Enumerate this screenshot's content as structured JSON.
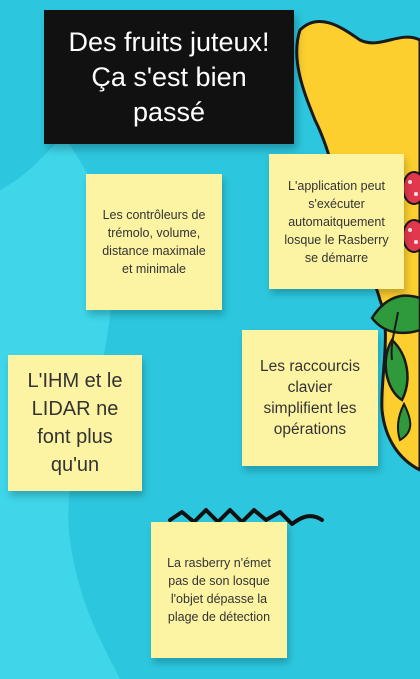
{
  "title_card": {
    "text": "Des fruits juteux!\nÇa s'est bien\npassé"
  },
  "notes": [
    {
      "text": "Les contrôleurs de trémolo, volume, distance maximale et minimale"
    },
    {
      "text": "L'application peut s'exécuter automaitquement losque le Rasberry se démarre"
    },
    {
      "text": "L'IHM et le LIDAR ne font plus qu'un"
    },
    {
      "text": "Les raccourcis clavier simplifient les opérations"
    },
    {
      "text": "La rasberry n'émet pas de son losque l'objet dépasse la plage de détection"
    }
  ],
  "colors": {
    "background": "#2cc7de",
    "light_wave": "#3fd6ea",
    "sticky_note": "#fdf4a3",
    "title_card": "#111111",
    "fruit_yellow": "#fccf2e",
    "leaf_green": "#2e9a3c",
    "raspberry_red": "#e2384e"
  }
}
